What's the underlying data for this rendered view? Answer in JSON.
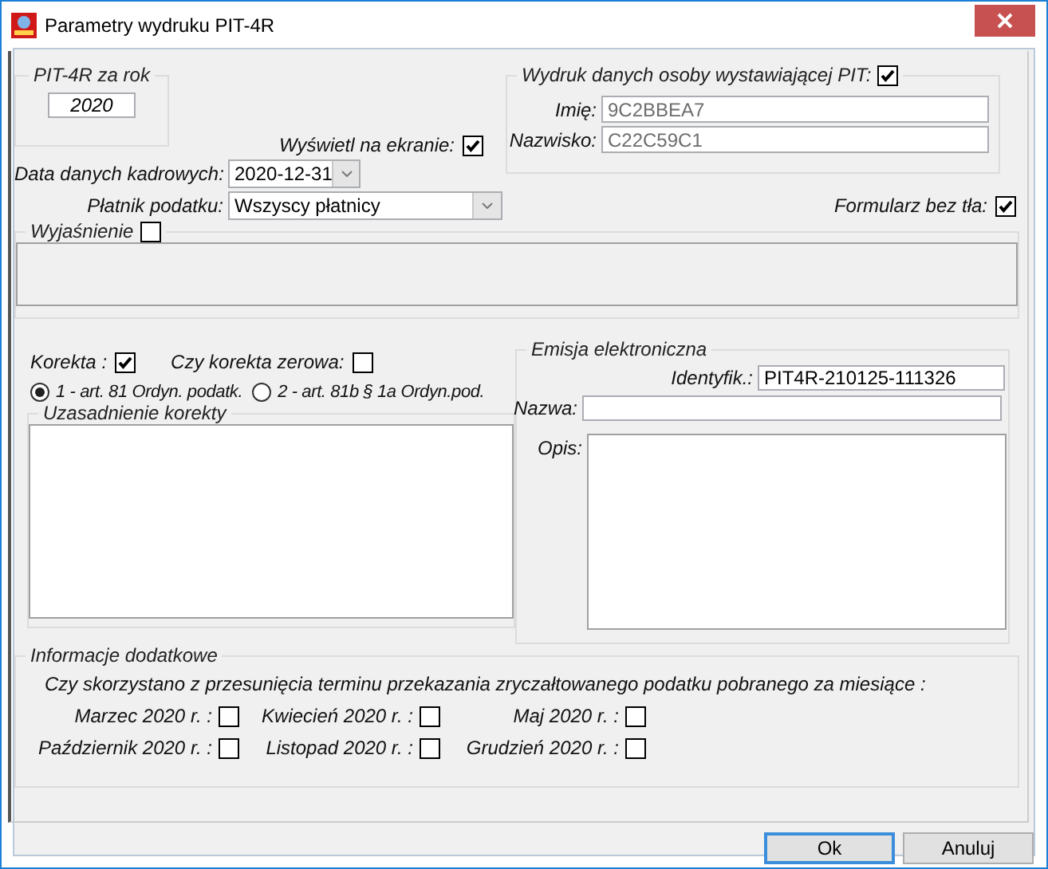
{
  "window": {
    "title": "Parametry wydruku PIT-4R"
  },
  "year_group": {
    "legend": "PIT-4R za rok",
    "value": "2020"
  },
  "show_on_screen": {
    "label": "Wyświetl na ekranie:",
    "checked": true
  },
  "personnel_date": {
    "label": "Data danych kadrowych:",
    "value": "2020-12-31"
  },
  "payer": {
    "label": "Płatnik podatku:",
    "value": "Wszyscy płatnicy"
  },
  "issuer_group": {
    "legend": "Wydruk danych osoby wystawiającej PIT:",
    "checked": true,
    "fields": [
      {
        "label": "Imię:",
        "value": "9C2BBEA7",
        "disabled": true
      },
      {
        "label": "Nazwisko:",
        "value": "C22C59C1",
        "disabled": true
      }
    ]
  },
  "no_background": {
    "label": "Formularz bez tła:",
    "checked": true
  },
  "explanation": {
    "legend": "Wyjaśnienie",
    "checked": false
  },
  "correction": {
    "label": "Korekta :",
    "checked": true
  },
  "zero_correction": {
    "label": "Czy korekta zerowa:",
    "checked": false
  },
  "correction_basis": [
    {
      "label": "1 - art. 81 Ordyn. podatk.",
      "selected": true
    },
    {
      "label": "2 - art. 81b § 1a Ordyn.pod.",
      "selected": false
    }
  ],
  "justification": {
    "legend": "Uzasadnienie korekty"
  },
  "e_submission": {
    "legend": "Emisja elektroniczna",
    "fields": [
      {
        "label": "Identyfik.:",
        "value": "PIT4R-210125-111326",
        "kind": "input"
      },
      {
        "label": "Nazwa:",
        "kind": "input"
      },
      {
        "label": "Opis:",
        "kind": "textarea"
      }
    ]
  },
  "additional_info": {
    "legend": "Informacje dodatkowe",
    "question": "Czy skorzystano z przesunięcia terminu przekazania zryczałtowanego podatku pobranego za miesiące :",
    "months": [
      {
        "label": "Marzec 2020 r. :",
        "checked": false
      },
      {
        "label": "Kwiecień 2020 r. :",
        "checked": false
      },
      {
        "label": "Maj 2020 r. :",
        "checked": false
      },
      {
        "label": "Październik 2020 r. :",
        "checked": false
      },
      {
        "label": "Listopad 2020 r. :",
        "checked": false
      },
      {
        "label": "Grudzień 2020 r. :",
        "checked": false
      }
    ]
  },
  "buttons": [
    {
      "label": "Ok",
      "default": true
    },
    {
      "label": "Anuluj",
      "default": false
    }
  ]
}
